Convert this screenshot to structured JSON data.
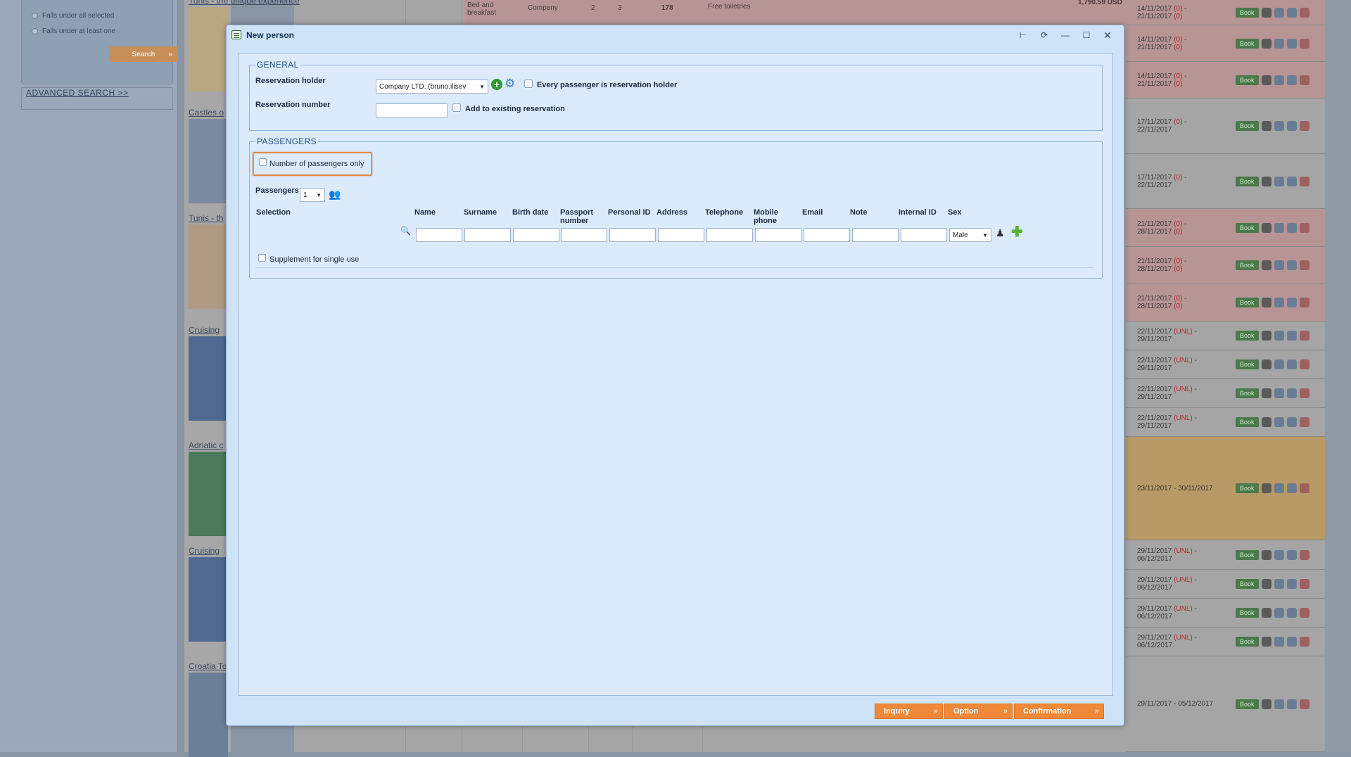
{
  "background": {
    "filter": {
      "option_all": "Falls under all selected",
      "option_one": "Falls under at least one",
      "search_label": "Search"
    },
    "advanced_search": "ADVANCED SEARCH >>",
    "tours": [
      "Tunis - the unique experience",
      "Castles o",
      "Tunis - th",
      "Cruising",
      "Adriatic c",
      "Cruising",
      "Croatia To"
    ],
    "strip": {
      "board": "Bed and\nbreakfast",
      "holder": "Company",
      "n1": "2",
      "n2": "3",
      "n3": "178",
      "desc": "Free toiletries",
      "price": "1,790.59 USD"
    },
    "book_label": "Book",
    "rows": [
      {
        "date": "14/11/2017",
        "extra1": "(0)",
        "date2": "21/11/2017",
        "extra2": "(0)"
      },
      {
        "date": "14/11/2017",
        "extra1": "(0)",
        "date2": "21/11/2017",
        "extra2": "(0)"
      },
      {
        "date": "14/11/2017",
        "extra1": "(0)",
        "date2": "21/11/2017",
        "extra2": "(0)"
      },
      {
        "date": "17/11/2017",
        "extra1": "(0)",
        "date2": "22/11/2017",
        "extra2": ""
      },
      {
        "date": "17/11/2017",
        "extra1": "(0)",
        "date2": "22/11/2017",
        "extra2": ""
      },
      {
        "date": "21/11/2017",
        "extra1": "(0)",
        "date2": "28/11/2017",
        "extra2": "(0)"
      },
      {
        "date": "21/11/2017",
        "extra1": "(0)",
        "date2": "28/11/2017",
        "extra2": "(0)"
      },
      {
        "date": "21/11/2017",
        "extra1": "(0)",
        "date2": "28/11/2017",
        "extra2": "(0)"
      },
      {
        "date": "22/11/2017",
        "extra1": "(UNL)",
        "date2": "29/11/2017",
        "extra2": ""
      },
      {
        "date": "22/11/2017",
        "extra1": "(UNL)",
        "date2": "29/11/2017",
        "extra2": ""
      },
      {
        "date": "22/11/2017",
        "extra1": "(UNL)",
        "date2": "29/11/2017",
        "extra2": ""
      },
      {
        "date": "22/11/2017",
        "extra1": "(UNL)",
        "date2": "29/11/2017",
        "extra2": ""
      },
      {
        "date": "23/11/2017 - 30/11/2017",
        "extra1": "",
        "date2": "",
        "extra2": ""
      },
      {
        "date": "29/11/2017",
        "extra1": "(UNL)",
        "date2": "06/12/2017",
        "extra2": ""
      },
      {
        "date": "29/11/2017",
        "extra1": "(UNL)",
        "date2": "06/12/2017",
        "extra2": ""
      },
      {
        "date": "29/11/2017",
        "extra1": "(UNL)",
        "date2": "06/12/2017",
        "extra2": ""
      },
      {
        "date": "29/11/2017",
        "extra1": "(UNL)",
        "date2": "06/12/2017",
        "extra2": ""
      },
      {
        "date": "29/11/2017 - 05/12/2017",
        "extra1": "",
        "date2": "",
        "extra2": ""
      }
    ]
  },
  "dialog": {
    "title": "New person",
    "general": {
      "legend": "GENERAL",
      "reservation_holder_label": "Reservation holder",
      "reservation_holder_value": "Company LTD. (bruno.ilisev",
      "every_passenger_label": "Every passenger is reservation holder",
      "reservation_number_label": "Reservation number",
      "reservation_number_value": "",
      "add_existing_label": "Add to existing reservation"
    },
    "passengers": {
      "legend": "PASSENGERS",
      "number_only_label": "Number of passengers only",
      "passengers_label": "Passengers",
      "passengers_count": "1",
      "columns": {
        "selection": "Selection",
        "name": "Name",
        "surname": "Surname",
        "birth_date": "Birth date",
        "passport_number": "Passport number",
        "personal_id": "Personal ID",
        "address": "Address",
        "telephone": "Telephone",
        "mobile_phone": "Mobile phone",
        "email": "Email",
        "note": "Note",
        "internal_id": "Internal ID",
        "sex": "Sex"
      },
      "sex_value": "Male",
      "supplement_label": "Supplement for single use"
    },
    "buttons": {
      "inquiry": "Inquiry",
      "option": "Option",
      "confirmation": "Confirmation"
    }
  }
}
